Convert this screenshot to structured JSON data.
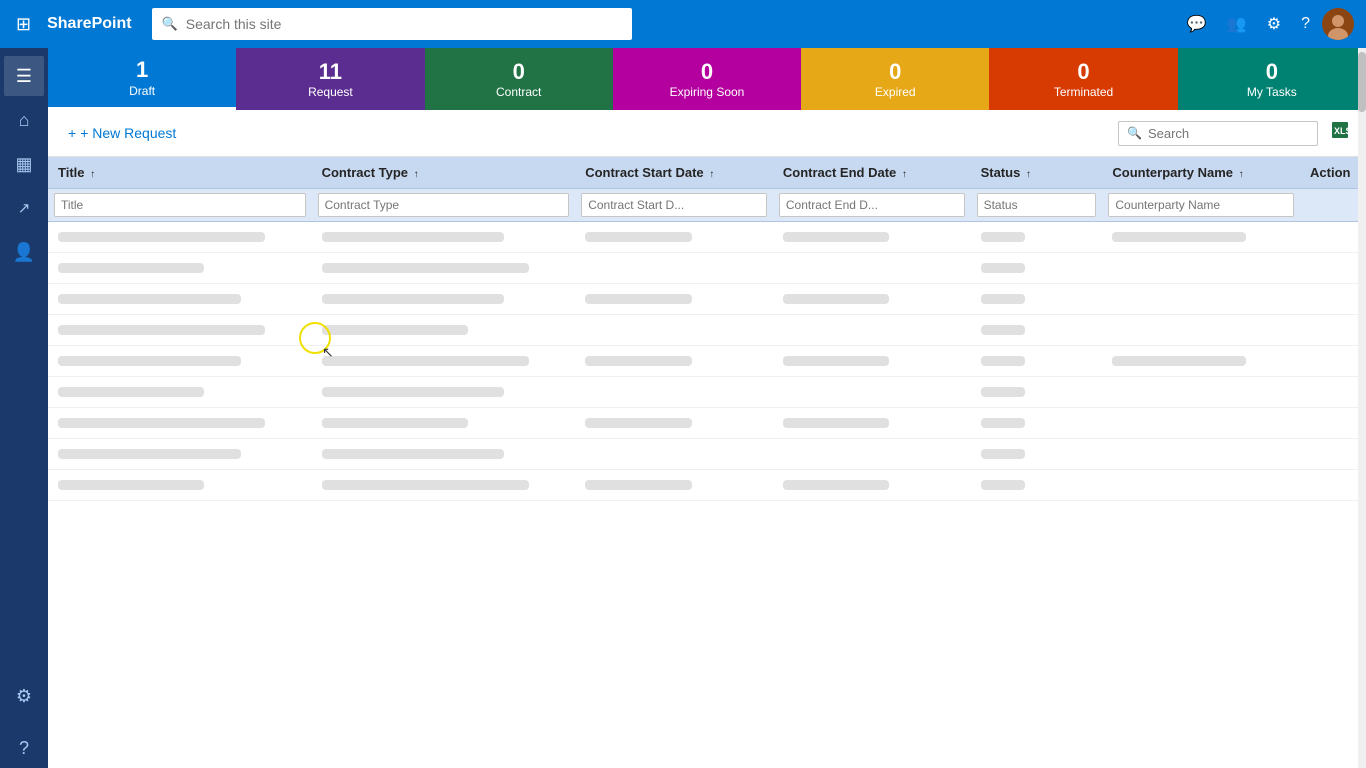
{
  "topNav": {
    "appName": "SharePoint",
    "searchPlaceholder": "Search this site",
    "icons": {
      "waffle": "⊞",
      "chat": "💬",
      "people": "👥",
      "settings": "⚙",
      "help": "?"
    }
  },
  "sidebar": {
    "items": [
      {
        "id": "hamburger",
        "icon": "☰",
        "label": "Menu",
        "active": true
      },
      {
        "id": "home",
        "icon": "⌂",
        "label": "Home"
      },
      {
        "id": "dashboard",
        "icon": "▦",
        "label": "Dashboard"
      },
      {
        "id": "analytics",
        "icon": "↗",
        "label": "Analytics"
      },
      {
        "id": "people",
        "icon": "👤",
        "label": "People"
      },
      {
        "id": "settings",
        "icon": "⚙",
        "label": "Settings"
      },
      {
        "id": "help",
        "icon": "?",
        "label": "Help"
      }
    ]
  },
  "statusCards": [
    {
      "id": "draft",
      "count": "1",
      "label": "Draft",
      "colorClass": "draft",
      "active": true
    },
    {
      "id": "request",
      "count": "11",
      "label": "Request",
      "colorClass": "request"
    },
    {
      "id": "contract",
      "count": "0",
      "label": "Contract",
      "colorClass": "contract"
    },
    {
      "id": "expiring",
      "count": "0",
      "label": "Expiring Soon",
      "colorClass": "expiring"
    },
    {
      "id": "expired",
      "count": "0",
      "label": "Expired",
      "colorClass": "expired"
    },
    {
      "id": "terminated",
      "count": "0",
      "label": "Terminated",
      "colorClass": "terminated"
    },
    {
      "id": "mytasks",
      "count": "0",
      "label": "My Tasks",
      "colorClass": "mytasks"
    }
  ],
  "toolbar": {
    "newRequestLabel": "+ New Request",
    "searchPlaceholder": "Search"
  },
  "table": {
    "columns": [
      {
        "id": "title",
        "label": "Title",
        "filterPlaceholder": "Title",
        "width": "20%"
      },
      {
        "id": "contractType",
        "label": "Contract Type",
        "filterPlaceholder": "Contract Type",
        "width": "20%"
      },
      {
        "id": "contractStartDate",
        "label": "Contract Start Date",
        "filterPlaceholder": "Contract Start D...",
        "width": "15%"
      },
      {
        "id": "contractEndDate",
        "label": "Contract End Date",
        "filterPlaceholder": "Contract End D...",
        "width": "15%"
      },
      {
        "id": "status",
        "label": "Status",
        "filterPlaceholder": "Status",
        "width": "10%"
      },
      {
        "id": "counterpartyName",
        "label": "Counterparty Name",
        "filterPlaceholder": "Counterparty Name",
        "width": "15%"
      },
      {
        "id": "action",
        "label": "Action",
        "filterPlaceholder": "",
        "width": "5%"
      }
    ],
    "skeletonRows": 9,
    "skeletonPattern": [
      "long",
      "medium",
      "short",
      "short",
      "tiny",
      "medium",
      ""
    ],
    "skeletonPattern2": [
      "short",
      "medium",
      "short",
      "short",
      "tiny",
      "",
      ""
    ],
    "skeletonPattern3": [
      "medium",
      "short",
      "short",
      "short",
      "tiny",
      "",
      ""
    ]
  }
}
